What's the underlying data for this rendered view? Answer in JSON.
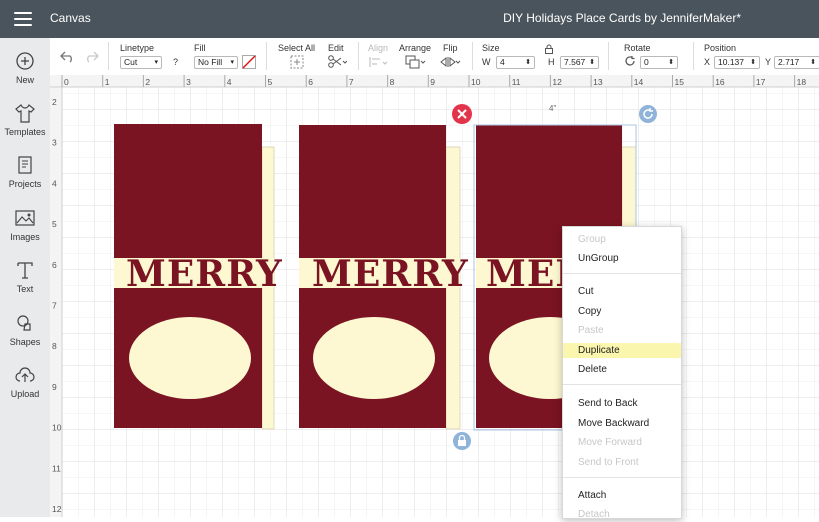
{
  "app": {
    "name": "Canvas",
    "document_title": "DIY Holidays Place Cards by JenniferMaker*"
  },
  "sidebar": {
    "items": [
      {
        "label": "New",
        "icon": "plus-circle-icon"
      },
      {
        "label": "Templates",
        "icon": "tshirt-icon"
      },
      {
        "label": "Projects",
        "icon": "projects-icon"
      },
      {
        "label": "Images",
        "icon": "image-icon"
      },
      {
        "label": "Text",
        "icon": "text-icon"
      },
      {
        "label": "Shapes",
        "icon": "shapes-icon"
      },
      {
        "label": "Upload",
        "icon": "upload-cloud-icon"
      }
    ]
  },
  "toolbar": {
    "linetype": {
      "label": "Linetype",
      "value": "Cut"
    },
    "fill": {
      "label": "Fill",
      "value": "No Fill"
    },
    "help": "?",
    "select_all": {
      "label": "Select All"
    },
    "edit": {
      "label": "Edit"
    },
    "align": {
      "label": "Align"
    },
    "arrange": {
      "label": "Arrange"
    },
    "flip": {
      "label": "Flip"
    },
    "size": {
      "label": "Size",
      "w_label": "W",
      "w_value": "4",
      "h_label": "H",
      "h_value": "7.567"
    },
    "rotate": {
      "label": "Rotate",
      "value": "0"
    },
    "position": {
      "label": "Position",
      "x_label": "X",
      "x_value": "10.137",
      "y_label": "Y",
      "y_value": "2.717"
    }
  },
  "rulers": {
    "top": [
      "0",
      "1",
      "2",
      "3",
      "4",
      "5",
      "6",
      "7",
      "8",
      "9",
      "10",
      "11",
      "12",
      "13",
      "14",
      "15",
      "16",
      "17",
      "18"
    ],
    "left": [
      "2",
      "3",
      "4",
      "5",
      "6",
      "7",
      "8",
      "9",
      "10",
      "11",
      "12"
    ]
  },
  "canvas": {
    "size_hint": "4\"",
    "cards": [
      {
        "word": "MERRY"
      },
      {
        "word": "MERRY"
      },
      {
        "word": "MERRY"
      }
    ]
  },
  "context_menu": {
    "items": [
      {
        "label": "Group",
        "enabled": false
      },
      {
        "label": "UnGroup",
        "enabled": true
      },
      {
        "label": "Cut",
        "enabled": true
      },
      {
        "label": "Copy",
        "enabled": true
      },
      {
        "label": "Paste",
        "enabled": false
      },
      {
        "label": "Duplicate",
        "enabled": true,
        "highlighted": true
      },
      {
        "label": "Delete",
        "enabled": true
      },
      {
        "label": "Send to Back",
        "enabled": true
      },
      {
        "label": "Move Backward",
        "enabled": true
      },
      {
        "label": "Move Forward",
        "enabled": false
      },
      {
        "label": "Send to Front",
        "enabled": false
      },
      {
        "label": "Attach",
        "enabled": true
      },
      {
        "label": "Detach",
        "enabled": false
      }
    ]
  },
  "colors": {
    "titlebar": "#4a545c",
    "card_red": "#7b1422",
    "card_cream": "#fdf8d2",
    "grid_line": "#e3e3e3",
    "selection_blue": "#a8c6e6",
    "delete_handle": "#e2344a",
    "rotate_handle": "#8fb3d9",
    "menu_highlight": "#fbf6ad"
  }
}
